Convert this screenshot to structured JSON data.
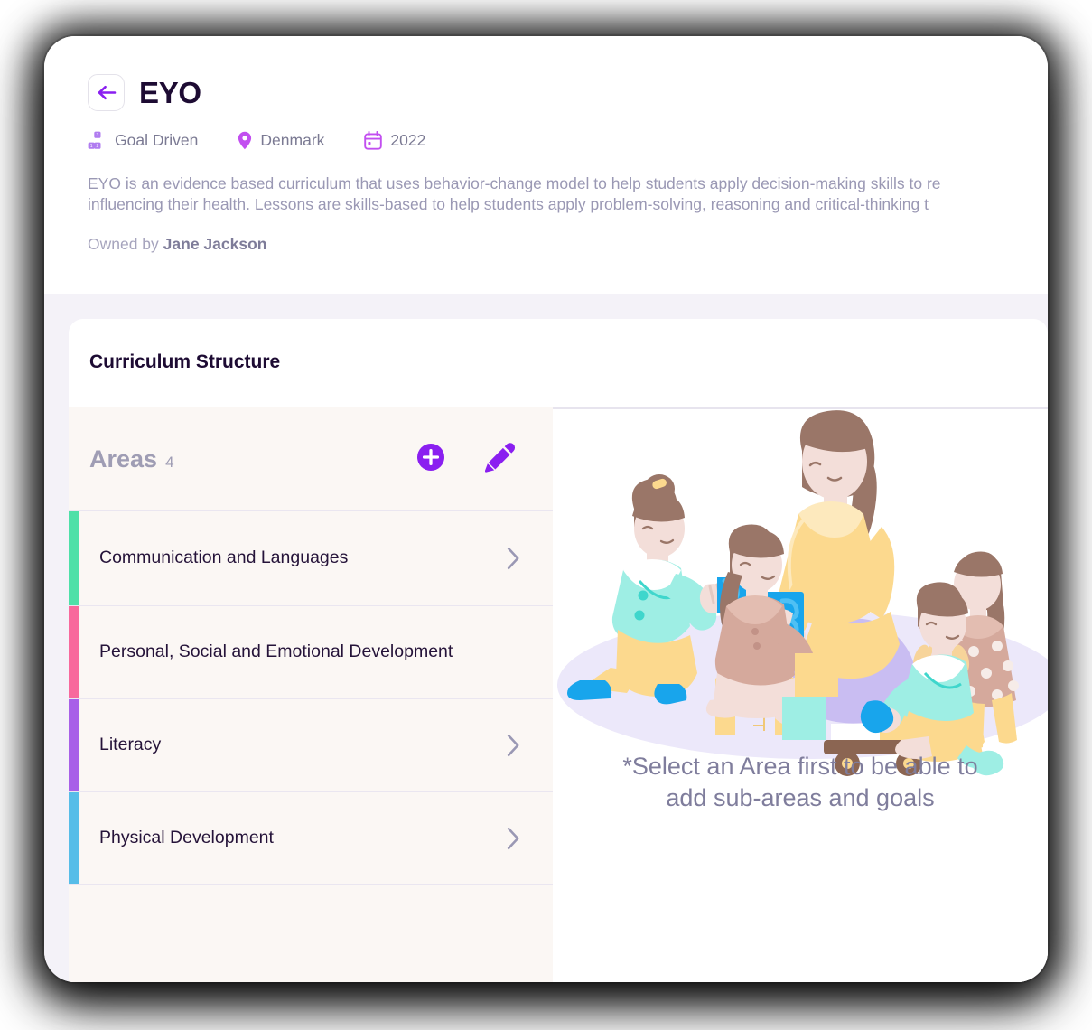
{
  "header": {
    "back_icon": "arrow-left-icon",
    "title": "EYO",
    "meta": [
      {
        "icon": "blocks-icon",
        "label": "Goal Driven"
      },
      {
        "icon": "location-pin-icon",
        "label": "Denmark"
      },
      {
        "icon": "calendar-icon",
        "label": "2022"
      }
    ],
    "description_line_1": "EYO is an evidence based curriculum that uses behavior-change model to help students apply decision-making skills to re",
    "description_line_2": "influencing their health. Lessons are skills-based to help students apply problem-solving, reasoning and critical-thinking t",
    "owner_prefix": "Owned by",
    "owner_name": "Jane Jackson"
  },
  "structure": {
    "title": "Curriculum Structure",
    "areas_label": "Areas",
    "areas_count": "4",
    "add_icon": "plus-circle-icon",
    "edit_icon": "pencil-icon",
    "areas": [
      {
        "name": "Communication and Languages",
        "color": "#4ee0a8",
        "has_chevron": true
      },
      {
        "name": "Personal, Social and Emotional Development",
        "color": "#f8699c",
        "has_chevron": false
      },
      {
        "name": "Literacy",
        "color": "#a860e8",
        "has_chevron": true
      },
      {
        "name": "Physical Development",
        "color": "#57bde8",
        "has_chevron": true
      }
    ]
  },
  "empty_state": {
    "illustration": "children-playing-with-blocks-illustration",
    "message_line_1": "*Select an Area first to be able to",
    "message_line_2": "add sub-areas and goals"
  },
  "colors": {
    "accent": "#8a1ff0",
    "title": "#1d0b33",
    "muted": "#9a98b4",
    "panel_bg": "#fbf7f4",
    "page_bg": "#f4f2f8"
  }
}
